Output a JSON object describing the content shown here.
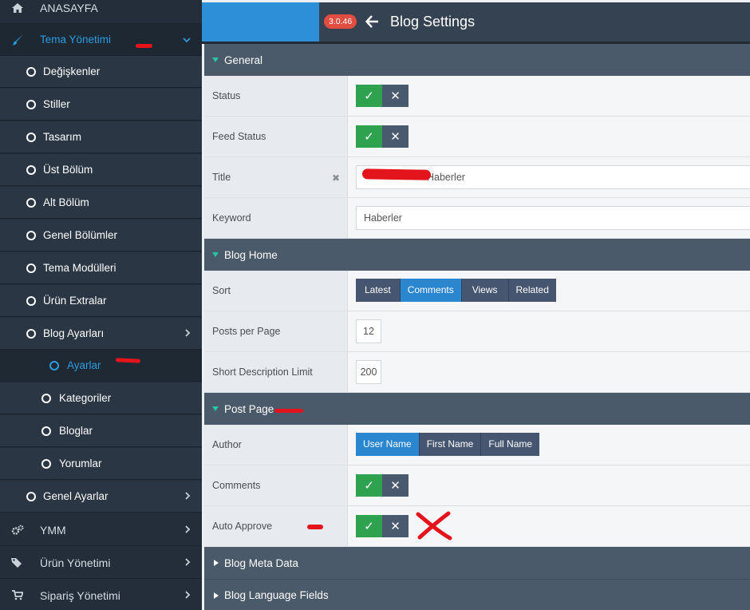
{
  "sidebar": {
    "items": [
      {
        "label": "ANASAYFA",
        "icon": "home-icon"
      },
      {
        "label": "Tema Yönetimi",
        "icon": "paintbrush-icon"
      },
      {
        "label": "Değişkenler"
      },
      {
        "label": "Stiller"
      },
      {
        "label": "Tasarım"
      },
      {
        "label": "Üst Bölüm"
      },
      {
        "label": "Alt Bölüm"
      },
      {
        "label": "Genel Bölümler"
      },
      {
        "label": "Tema Modülleri"
      },
      {
        "label": "Ürün Extralar"
      },
      {
        "label": "Blog Ayarları"
      },
      {
        "label": "Ayarlar"
      },
      {
        "label": "Kategoriler"
      },
      {
        "label": "Bloglar"
      },
      {
        "label": "Yorumlar"
      },
      {
        "label": "Genel Ayarlar"
      },
      {
        "label": "YMM",
        "icon": "cogs-icon"
      },
      {
        "label": "Ürün Yönetimi",
        "icon": "tags-icon"
      },
      {
        "label": "Sipariş Yönetimi",
        "icon": "cart-icon"
      }
    ]
  },
  "header": {
    "version": "3.0.46",
    "title": "Blog Settings"
  },
  "sections": {
    "general": "General",
    "blog_home": "Blog Home",
    "post_page": "Post Page",
    "meta_data": "Blog Meta Data",
    "language_fields": "Blog Language Fields"
  },
  "fields": {
    "status": "Status",
    "feed_status": "Feed Status",
    "title": "Title",
    "title_value": "Haberler",
    "keyword": "Keyword",
    "keyword_value": "Haberler",
    "sort": "Sort",
    "sort_options": [
      "Latest",
      "Comments",
      "Views",
      "Related"
    ],
    "sort_selected": "Comments",
    "posts_per_page": "Posts per Page",
    "posts_per_page_value": "12",
    "short_desc_limit": "Short Description Limit",
    "short_desc_limit_value": "200",
    "author": "Author",
    "author_options": [
      "User Name",
      "First Name",
      "Full Name"
    ],
    "author_selected": "User Name",
    "comments": "Comments",
    "auto_approve": "Auto Approve"
  },
  "colors": {
    "sidebar_bg": "#232e3a",
    "accent_blue": "#2d8fd8",
    "toggle_yes": "#2ea24f",
    "toggle_no": "#4a5a6e",
    "section_bg": "#4b5a6b",
    "badge_red": "#e24d42"
  }
}
